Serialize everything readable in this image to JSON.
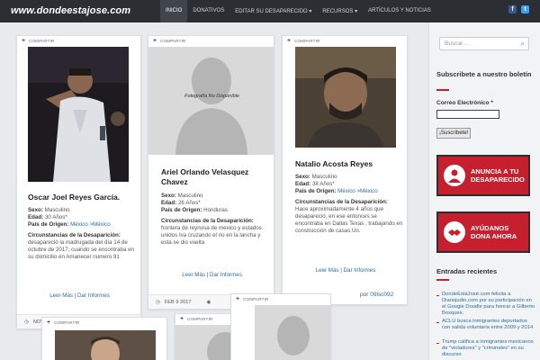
{
  "site": {
    "logo": "www.dondeestajose.com"
  },
  "nav": [
    {
      "label": "INICIO",
      "active": true
    },
    {
      "label": "DONATIVOS",
      "active": false
    },
    {
      "label": "EDITAR SU DESAPARECIDO ▾",
      "active": false
    },
    {
      "label": "RECURSOS ▾",
      "active": false
    },
    {
      "label": "ARTÍCULOS Y NOTICIAS",
      "active": false
    }
  ],
  "social": {
    "facebook": "f",
    "twitter": "t"
  },
  "share_label": "COMPARTIR",
  "cards": [
    {
      "name": "Oscar Joel Reyes García.",
      "sexo_label": "Sexo:",
      "sexo": "Masculino",
      "edad_label": "Edad:",
      "edad": "30 Años*",
      "pais_label": "País de Origen:",
      "pais": "México >México",
      "circ_label": "Circunstancias de la Desaparición:",
      "circ": "desapareció la madrugada del día 14 de octubre de 2017, cuando se encontraba en su domicilio en Amanecer numero 91",
      "leer": "Leer Más",
      "dar": "Dar Informes",
      "date": "NOV"
    },
    {
      "name": "Ariel Orlando Velasquez Chavez",
      "photo_text": "Fotografía No Disponible",
      "sexo_label": "Sexo:",
      "sexo": "Masculino",
      "edad_label": "Edad:",
      "edad": "26 Años*",
      "pais_label": "País de Origen:",
      "pais": "Honduras",
      "circ_label": "Circunstancias de la Desaparición:",
      "circ": "frontera de reynosa de mexico y estados unidos Iva cruzando el rio en la lancha y esta se dio vuelta",
      "leer": "Leer Más",
      "dar": "Dar Informes",
      "date": "FEB 9 2017"
    },
    {
      "name": "Natalio Acosta Reyes",
      "sexo_label": "Sexo:",
      "sexo": "Masculino",
      "edad_label": "Edad:",
      "edad": "38 Años*",
      "pais_label": "País de Origen:",
      "pais": "México >México",
      "circ_label": "Circunstancias de la Desaparición:",
      "circ": "Hace aproximadamente 4 años que desapareció, en ese entonces se encontraba en Dallas Texas , trabajando en construcción de casas.Un.",
      "leer": "Leer Más",
      "dar": "Dar Informes",
      "author_prefix": "por",
      "author": "09lsc092"
    }
  ],
  "sidebar": {
    "search_placeholder": "Buscar ...",
    "subscribe_title": "Subscribete a nuestro boletín",
    "email_label": "Correo Electrónico *",
    "subscribe_button": "¡Suscríbete!",
    "banner1": "ANUNCIA A TU DESAPARECIDO",
    "banner2": "AYÚDANOS DONA AHORA",
    "recent_title": "Entradas recientes",
    "recent": [
      "DondeEstáJosé.com felicita a Dianojudio.com por su participación en el Google Doodle para honrar a Gilberto Bosques.",
      "ACLU busca inmigrantes deportados con salida voluntaria entre 2009 y 2014",
      "Trump califica a inmigrantes mexicanos de \"violadores\" y \"criminales\" en su discurso"
    ]
  },
  "colors": {
    "nav_bg": "#2b2f33",
    "accent_red": "#c8202e",
    "link_blue": "#2c6e9b"
  }
}
